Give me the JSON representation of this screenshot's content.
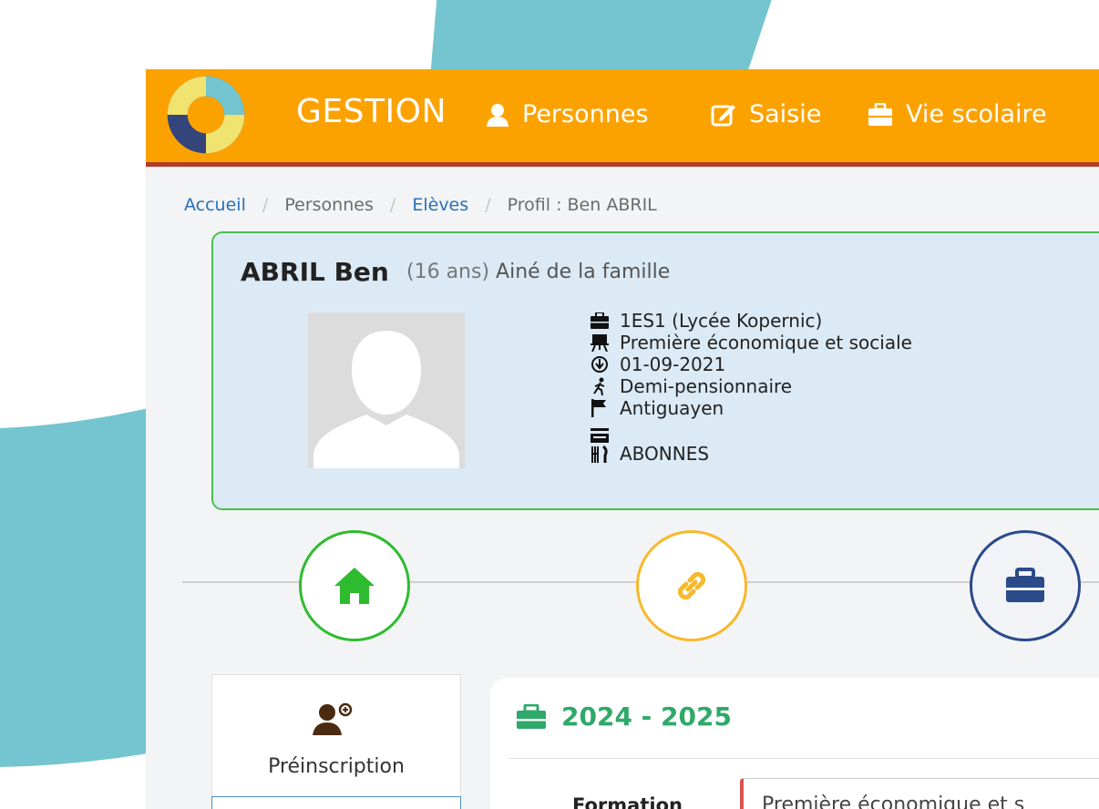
{
  "navbar": {
    "brand": "GESTION",
    "items": [
      {
        "label": "Personnes",
        "icon": "user-icon"
      },
      {
        "label": "Saisie",
        "icon": "edit-icon"
      },
      {
        "label": "Vie scolaire",
        "icon": "briefcase-icon"
      }
    ]
  },
  "breadcrumb": {
    "items": [
      "Accueil",
      "Personnes",
      "Elèves",
      "Profil : Ben ABRIL"
    ]
  },
  "profile": {
    "name": "ABRIL Ben",
    "age": "(16 ans)",
    "family_rank": "Ainé de la famille",
    "info": [
      {
        "icon": "briefcase-icon",
        "text": "1ES1 (Lycée Kopernic)"
      },
      {
        "icon": "easel-icon",
        "text": "Première économique et sociale"
      },
      {
        "icon": "arrow-circle-down-icon",
        "text": "01-09-2021"
      },
      {
        "icon": "walking-icon",
        "text": "Demi-pensionnaire"
      },
      {
        "icon": "flag-icon",
        "text": "Antiguayen"
      },
      {
        "icon": "canteen-icon",
        "text": "ABONNES"
      }
    ]
  },
  "steps": [
    {
      "icon": "home-icon",
      "color": "#2fbb2f"
    },
    {
      "icon": "link-icon",
      "color": "#f7b92a"
    },
    {
      "icon": "briefcase-icon",
      "color": "#2b4a8a"
    }
  ],
  "side_panel": {
    "label": "Préinscription",
    "icon": "user-plus-icon"
  },
  "main_panel": {
    "year": "2024 - 2025",
    "field_label": "Formation",
    "field_value": "Première économique et s"
  },
  "colors": {
    "navbar": "#fca200",
    "navbar_border": "#b23b2a",
    "profile_bg": "#dbeaf5",
    "profile_border": "#4cbf4c",
    "accent_teal": "#74c5cf",
    "year_green": "#2fa96a"
  }
}
